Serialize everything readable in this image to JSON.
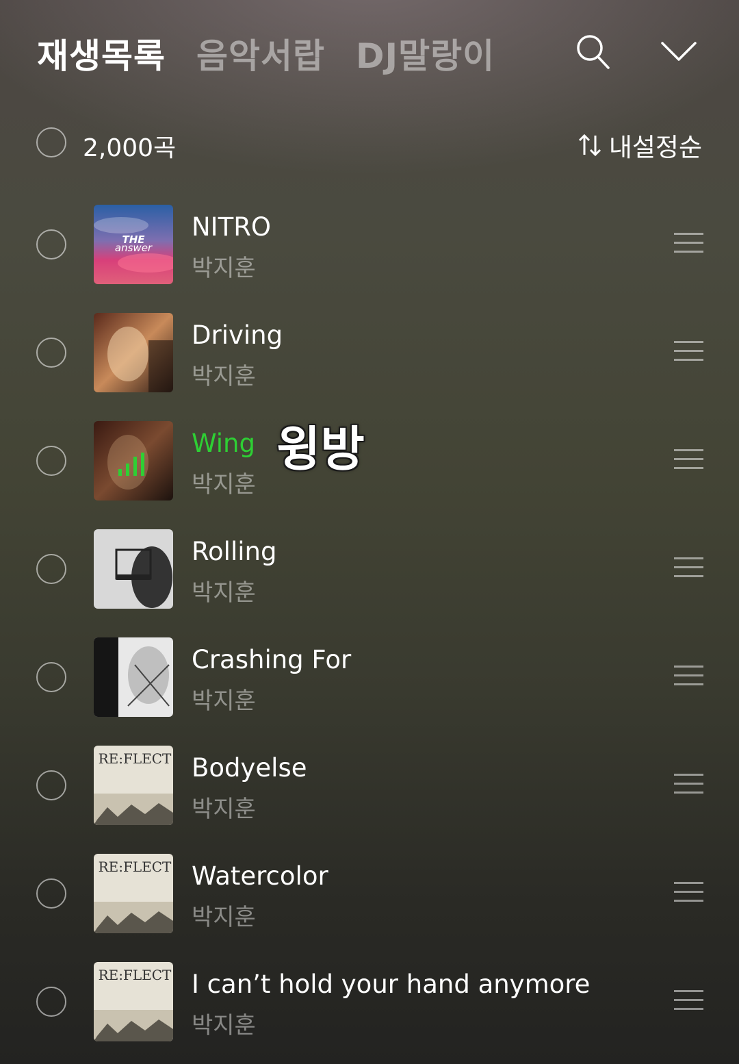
{
  "header": {
    "tabs": [
      {
        "label": "재생목록",
        "active": true
      },
      {
        "label": "음악서랍",
        "active": false
      },
      {
        "label": "DJ말랑이",
        "active": false
      }
    ],
    "search_icon": "search-icon",
    "collapse_icon": "chevron-down-icon"
  },
  "summary": {
    "count_label": "2,000곡",
    "sort_icon": "sort-arrows-icon",
    "sort_label": "내설정순"
  },
  "songs": [
    {
      "title": "NITRO",
      "artist": "박지훈",
      "playing": false
    },
    {
      "title": "Driving",
      "artist": "박지훈",
      "playing": false
    },
    {
      "title": "Wing",
      "artist": "박지훈",
      "playing": true
    },
    {
      "title": "Rolling",
      "artist": "박지훈",
      "playing": false
    },
    {
      "title": "Crashing For",
      "artist": "박지훈",
      "playing": false
    },
    {
      "title": "Bodyelse",
      "artist": "박지훈",
      "playing": false
    },
    {
      "title": "Watercolor",
      "artist": "박지훈",
      "playing": false
    },
    {
      "title": "I can’t hold your hand anymore",
      "artist": "박지훈",
      "playing": false
    }
  ],
  "overlay_text": "윙방",
  "colors": {
    "playing_accent": "#2ecf34"
  }
}
